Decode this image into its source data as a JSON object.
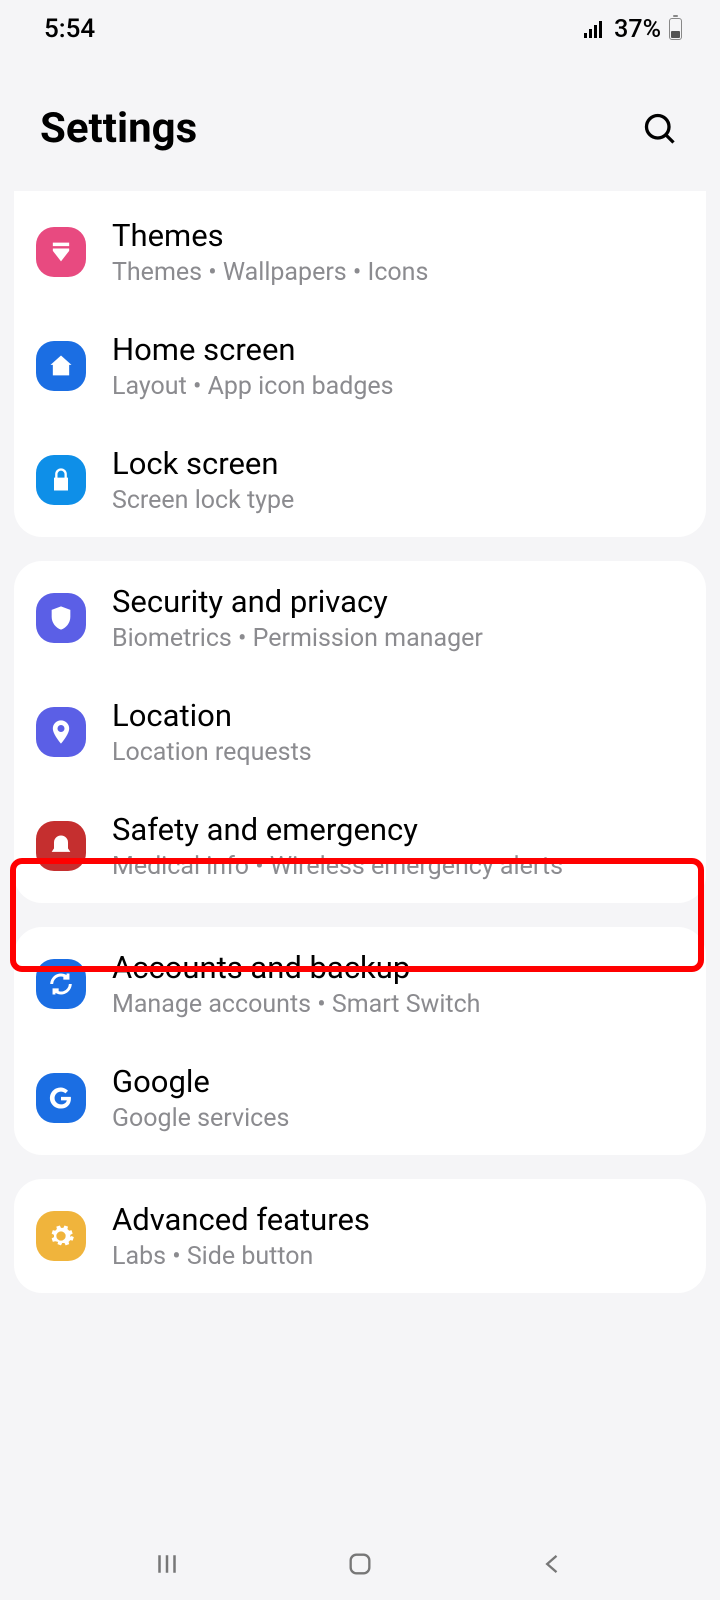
{
  "status": {
    "time": "5:54",
    "battery": "37%"
  },
  "header": {
    "title": "Settings"
  },
  "groups": [
    {
      "items": [
        {
          "title": "Themes",
          "sub": "Themes  •  Wallpapers  •  Icons",
          "icon": "themes",
          "color": "#e84a80"
        },
        {
          "title": "Home screen",
          "sub": "Layout  •  App icon badges",
          "icon": "home",
          "color": "#1b6ee3"
        },
        {
          "title": "Lock screen",
          "sub": "Screen lock type",
          "icon": "lock",
          "color": "#0e8fe8"
        }
      ]
    },
    {
      "items": [
        {
          "title": "Security and privacy",
          "sub": "Biometrics  •  Permission manager",
          "icon": "shield",
          "color": "#5b5fe6"
        },
        {
          "title": "Location",
          "sub": "Location requests",
          "icon": "pin",
          "color": "#5b5fe6"
        },
        {
          "title": "Safety and emergency",
          "sub": "Medical info  •  Wireless emergency alerts",
          "icon": "alert",
          "color": "#c52f2f"
        }
      ]
    },
    {
      "items": [
        {
          "title": "Accounts and backup",
          "sub": "Manage accounts  •  Smart Switch",
          "icon": "sync",
          "color": "#1b6ee3"
        },
        {
          "title": "Google",
          "sub": "Google services",
          "icon": "google",
          "color": "#1b6ee3"
        }
      ]
    },
    {
      "items": [
        {
          "title": "Advanced features",
          "sub": "Labs  •  Side button",
          "icon": "gear",
          "color": "#f0b43c"
        }
      ]
    }
  ]
}
